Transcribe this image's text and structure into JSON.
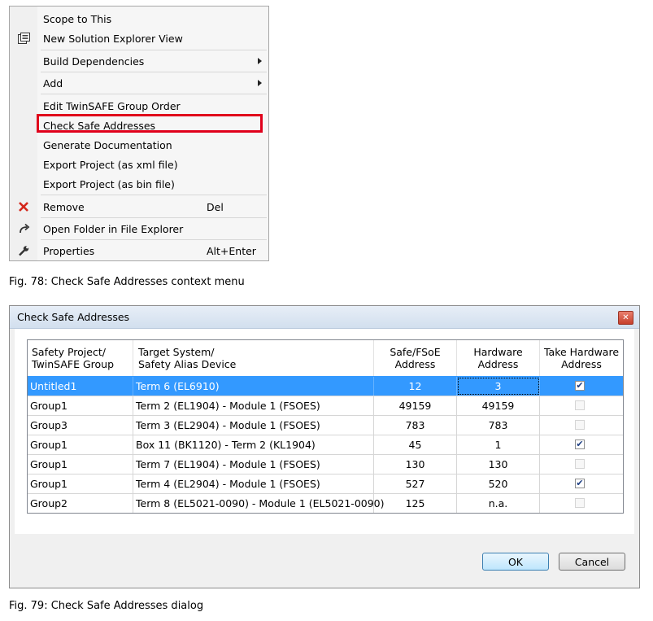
{
  "menu": {
    "items": [
      {
        "label": "Scope to This",
        "icon": "",
        "shortcut": "",
        "submenu": false
      },
      {
        "label": "New Solution Explorer View",
        "icon": "solution-explorer-icon",
        "shortcut": "",
        "submenu": false
      },
      {
        "label": "Build Dependencies",
        "icon": "",
        "shortcut": "",
        "submenu": true
      },
      {
        "label": "Add",
        "icon": "",
        "shortcut": "",
        "submenu": true
      },
      {
        "label": "Edit TwinSAFE Group Order",
        "icon": "",
        "shortcut": "",
        "submenu": false
      },
      {
        "label": "Check Safe Addresses",
        "icon": "",
        "shortcut": "",
        "submenu": false,
        "highlighted": true
      },
      {
        "label": "Generate Documentation",
        "icon": "",
        "shortcut": "",
        "submenu": false
      },
      {
        "label": "Export Project (as xml file)",
        "icon": "",
        "shortcut": "",
        "submenu": false
      },
      {
        "label": "Export Project (as bin file)",
        "icon": "",
        "shortcut": "",
        "submenu": false
      },
      {
        "label": "Remove",
        "icon": "remove-x-icon",
        "shortcut": "Del",
        "submenu": false
      },
      {
        "label": "Open Folder in File Explorer",
        "icon": "open-folder-arrow-icon",
        "shortcut": "",
        "submenu": false
      },
      {
        "label": "Properties",
        "icon": "wrench-icon",
        "shortcut": "Alt+Enter",
        "submenu": false
      }
    ],
    "highlight_color": "#e0001b"
  },
  "captions": {
    "fig78": "Fig. 78: Check Safe Addresses context menu",
    "fig79": "Fig. 79: Check Safe Addresses dialog"
  },
  "dialog": {
    "title": "Check Safe Addresses",
    "close_glyph": "✕",
    "columns": [
      {
        "line1": "Safety Project/",
        "line2": "TwinSAFE Group"
      },
      {
        "line1": "Target System/",
        "line2": "Safety Alias Device"
      },
      {
        "line1": "Safe/FSoE",
        "line2": "Address"
      },
      {
        "line1": "Hardware",
        "line2": "Address"
      },
      {
        "line1": "Take Hardware",
        "line2": "Address"
      }
    ],
    "rows": [
      {
        "group": "Untitled1",
        "target": "Term 6 (EL6910)",
        "safe_address": "12",
        "hw_address": "3",
        "take": true,
        "enabled": true,
        "selected": true
      },
      {
        "group": "Group1",
        "target": "Term 2 (EL1904) - Module 1 (FSOES)",
        "safe_address": "49159",
        "hw_address": "49159",
        "take": false,
        "enabled": false,
        "selected": false
      },
      {
        "group": "Group3",
        "target": "Term 3 (EL2904) - Module 1 (FSOES)",
        "safe_address": "783",
        "hw_address": "783",
        "take": false,
        "enabled": false,
        "selected": false
      },
      {
        "group": "Group1",
        "target": "Box 11 (BK1120) - Term 2 (KL1904)",
        "safe_address": "45",
        "hw_address": "1",
        "take": true,
        "enabled": true,
        "selected": false
      },
      {
        "group": "Group1",
        "target": "Term 7 (EL1904) - Module 1 (FSOES)",
        "safe_address": "130",
        "hw_address": "130",
        "take": false,
        "enabled": false,
        "selected": false
      },
      {
        "group": "Group1",
        "target": "Term 4 (EL2904) - Module 1 (FSOES)",
        "safe_address": "527",
        "hw_address": "520",
        "take": true,
        "enabled": true,
        "selected": false
      },
      {
        "group": "Group2",
        "target": "Term 8 (EL5021-0090) - Module 1 (EL5021-0090)",
        "safe_address": "125",
        "hw_address": "n.a.",
        "take": false,
        "enabled": false,
        "selected": false
      }
    ],
    "ok_label": "OK",
    "cancel_label": "Cancel",
    "selection_color": "#3399ff"
  }
}
